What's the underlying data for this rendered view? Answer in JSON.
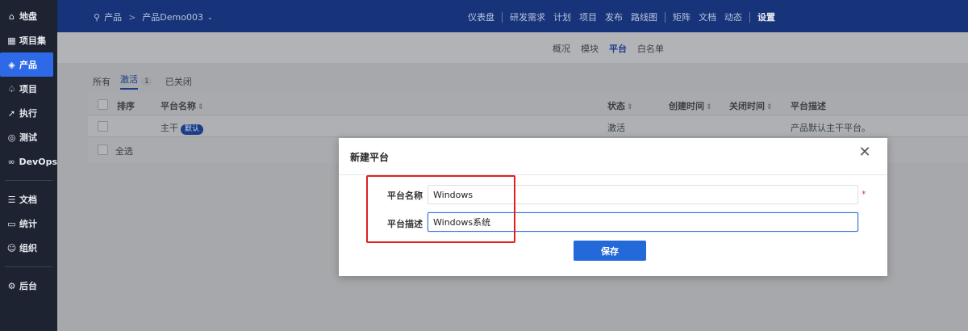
{
  "sidebar": {
    "items": [
      {
        "label": "地盘",
        "icon": "home-icon"
      },
      {
        "label": "项目集",
        "icon": "grid-icon"
      },
      {
        "label": "产品",
        "icon": "product-icon"
      },
      {
        "label": "项目",
        "icon": "project-icon"
      },
      {
        "label": "执行",
        "icon": "run-icon"
      },
      {
        "label": "测试",
        "icon": "test-icon"
      },
      {
        "label": "DevOps",
        "icon": "infinity-icon"
      },
      {
        "label": "文档",
        "icon": "doc-icon"
      },
      {
        "label": "统计",
        "icon": "chart-icon"
      },
      {
        "label": "组织",
        "icon": "people-icon"
      },
      {
        "label": "后台",
        "icon": "gear-icon"
      }
    ],
    "active_index": 2
  },
  "header": {
    "breadcrumb": {
      "root": "产品",
      "current": "产品Demo003"
    },
    "nav": [
      "仪表盘",
      "研发需求",
      "计划",
      "项目",
      "发布",
      "路线图",
      "矩阵",
      "文档",
      "动态",
      "设置"
    ]
  },
  "subnav": {
    "tabs": [
      "概况",
      "模块",
      "平台",
      "白名单"
    ],
    "active": "平台"
  },
  "filters": {
    "all": "所有",
    "active": "激活",
    "active_count": "1",
    "closed": "已关闭"
  },
  "table": {
    "columns": {
      "order": "排序",
      "name": "平台名称",
      "status": "状态",
      "created": "创建时间",
      "closed": "关闭时间",
      "desc": "平台描述"
    },
    "rows": [
      {
        "name": "主干",
        "badge": "默认",
        "status": "激活",
        "desc": "产品默认主干平台。"
      }
    ],
    "select_all": "全选"
  },
  "modal": {
    "title": "新建平台",
    "close_icon": "close-icon",
    "name_label": "平台名称",
    "name_value": "Windows",
    "desc_label": "平台描述",
    "desc_value": "Windows系统",
    "required_mark": "*",
    "save_label": "保存"
  },
  "colors": {
    "sidebar_bg": "#1d2331",
    "header_bg": "#17347a",
    "accent": "#2469d9",
    "highlight": "#e02020"
  }
}
